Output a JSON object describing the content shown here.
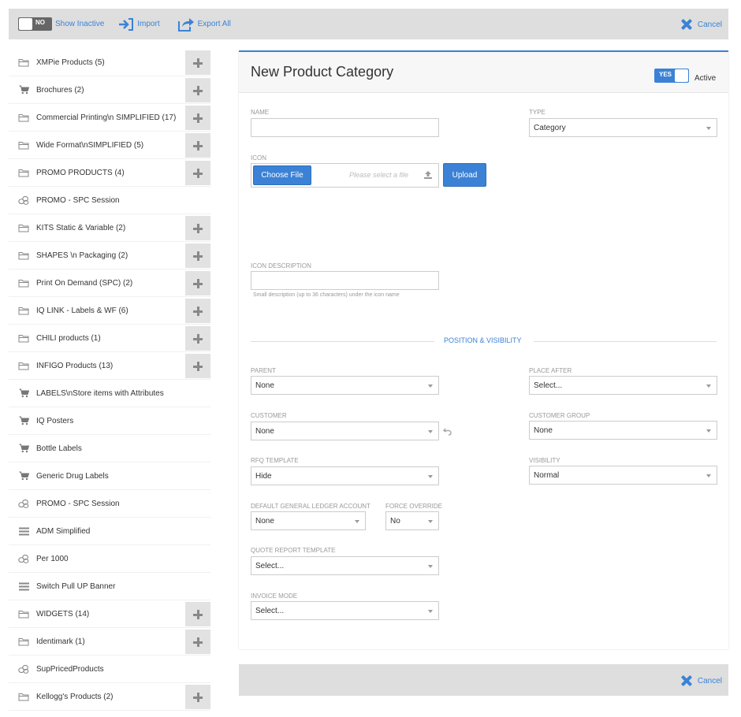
{
  "toolbar": {
    "inactive_toggle_text": "NO",
    "show_inactive_label": "Show Inactive",
    "import_label": "Import",
    "export_label": "Export All",
    "cancel_label": "Cancel"
  },
  "sidebar": {
    "items": [
      {
        "label": "XMPie Products (5)",
        "icon": "folder-icon",
        "has_add": true
      },
      {
        "label": "Brochures (2)",
        "icon": "cart-icon",
        "has_add": true
      },
      {
        "label": "Commercial Printing\\n SIMPLIFIED (17)",
        "icon": "folder-icon",
        "has_add": true
      },
      {
        "label": "Wide Format\\nSIMPLIFIED (5)",
        "icon": "folder-icon",
        "has_add": true
      },
      {
        "label": "PROMO PRODUCTS (4)",
        "icon": "folder-icon",
        "has_add": true
      },
      {
        "label": "PROMO - SPC Session",
        "icon": "coins-icon",
        "has_add": false
      },
      {
        "label": "KITS Static & Variable (2)",
        "icon": "folder-icon",
        "has_add": true
      },
      {
        "label": "SHAPES \\n Packaging (2)",
        "icon": "folder-icon",
        "has_add": true
      },
      {
        "label": "Print On Demand (SPC) (2)",
        "icon": "folder-icon",
        "has_add": true
      },
      {
        "label": "IQ LINK - Labels & WF (6)",
        "icon": "folder-icon",
        "has_add": true
      },
      {
        "label": "CHILI products (1)",
        "icon": "folder-icon",
        "has_add": true
      },
      {
        "label": "INFIGO Products (13)",
        "icon": "folder-icon",
        "has_add": true
      },
      {
        "label": "LABELS\\nStore items with Attributes",
        "icon": "cart-icon",
        "has_add": false
      },
      {
        "label": "IQ Posters",
        "icon": "cart-icon",
        "has_add": false
      },
      {
        "label": "Bottle Labels",
        "icon": "cart-icon",
        "has_add": false
      },
      {
        "label": "Generic Drug Labels",
        "icon": "cart-icon",
        "has_add": false
      },
      {
        "label": "PROMO - SPC Session",
        "icon": "coins-icon",
        "has_add": false
      },
      {
        "label": "ADM Simplified",
        "icon": "list-icon",
        "has_add": false
      },
      {
        "label": "Per 1000",
        "icon": "coins-icon",
        "has_add": false
      },
      {
        "label": "Switch Pull UP Banner",
        "icon": "list-icon",
        "has_add": false
      },
      {
        "label": "WIDGETS (14)",
        "icon": "folder-icon",
        "has_add": true
      },
      {
        "label": "Identimark (1)",
        "icon": "folder-icon",
        "has_add": true
      },
      {
        "label": "SupPricedProducts",
        "icon": "coins-icon",
        "has_add": false
      },
      {
        "label": "Kellogg's Products (2)",
        "icon": "folder-icon",
        "has_add": true
      }
    ]
  },
  "form": {
    "title": "New Product Category",
    "active_toggle_text": "YES",
    "active_label": "Active",
    "name_label": "NAME",
    "name_value": "",
    "type_label": "TYPE",
    "type_value": "Category",
    "icon_label": "ICON",
    "choose_file_label": "Choose File",
    "file_placeholder": "Please select a file",
    "upload_label": "Upload",
    "icon_desc_label": "ICON DESCRIPTION",
    "icon_desc_value": "",
    "icon_desc_hint": "Small description (up to 36 characters) under the icon name",
    "section_title": "POSITION & VISIBILITY",
    "parent_label": "PARENT",
    "parent_value": "None",
    "place_after_label": "PLACE AFTER",
    "place_after_value": "Select...",
    "customer_label": "CUSTOMER",
    "customer_value": "None",
    "customer_group_label": "CUSTOMER GROUP",
    "customer_group_value": "None",
    "rfq_label": "RFQ TEMPLATE",
    "rfq_value": "Hide",
    "visibility_label": "VISIBILITY",
    "visibility_value": "Normal",
    "gl_label": "DEFAULT GENERAL LEDGER ACCOUNT",
    "gl_value": "None",
    "force_label": "FORCE OVERRIDE",
    "force_value": "No",
    "quote_label": "QUOTE REPORT TEMPLATE",
    "quote_value": "Select...",
    "invoice_label": "INVOICE MODE",
    "invoice_value": "Select..."
  },
  "footer": {
    "cancel_label": "Cancel"
  },
  "colors": {
    "accent": "#3b82d6",
    "toolbar_bg": "#dedede"
  }
}
